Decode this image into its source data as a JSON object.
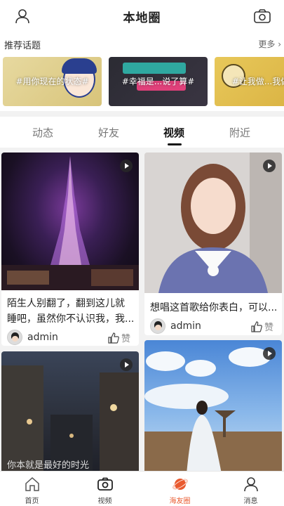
{
  "header": {
    "title": "本地圈"
  },
  "topics": {
    "section_title": "推荐话题",
    "more_label": "更多 ›",
    "items": [
      {
        "tag": "#用你现在的状态#"
      },
      {
        "tag": "#幸福是...说了算#"
      },
      {
        "tag": "#让我做...我做#"
      }
    ]
  },
  "tabs": [
    {
      "label": "动态"
    },
    {
      "label": "好友"
    },
    {
      "label": "视频"
    },
    {
      "label": "附近"
    }
  ],
  "active_tab": "视频",
  "feed": [
    {
      "caption_line1": "陌生人别翻了，翻到这儿就",
      "caption_line2": "睡吧，虽然你不认识我，我...",
      "author": "admin",
      "like_label": "赞"
    },
    {
      "caption_line1": "想唱这首歌给你表白，可以...",
      "author": "admin",
      "like_label": "赞"
    },
    {
      "caption_line1": "你本就是最好的时光"
    },
    {
      "caption_line1": ""
    }
  ],
  "bottom_nav": [
    {
      "label": "首页"
    },
    {
      "label": "视频"
    },
    {
      "label": "海友圈"
    },
    {
      "label": "消息"
    }
  ],
  "colors": {
    "accent": "#e95a2f",
    "text_primary": "#222222",
    "text_muted": "#888888",
    "background": "#f2f2f2"
  }
}
